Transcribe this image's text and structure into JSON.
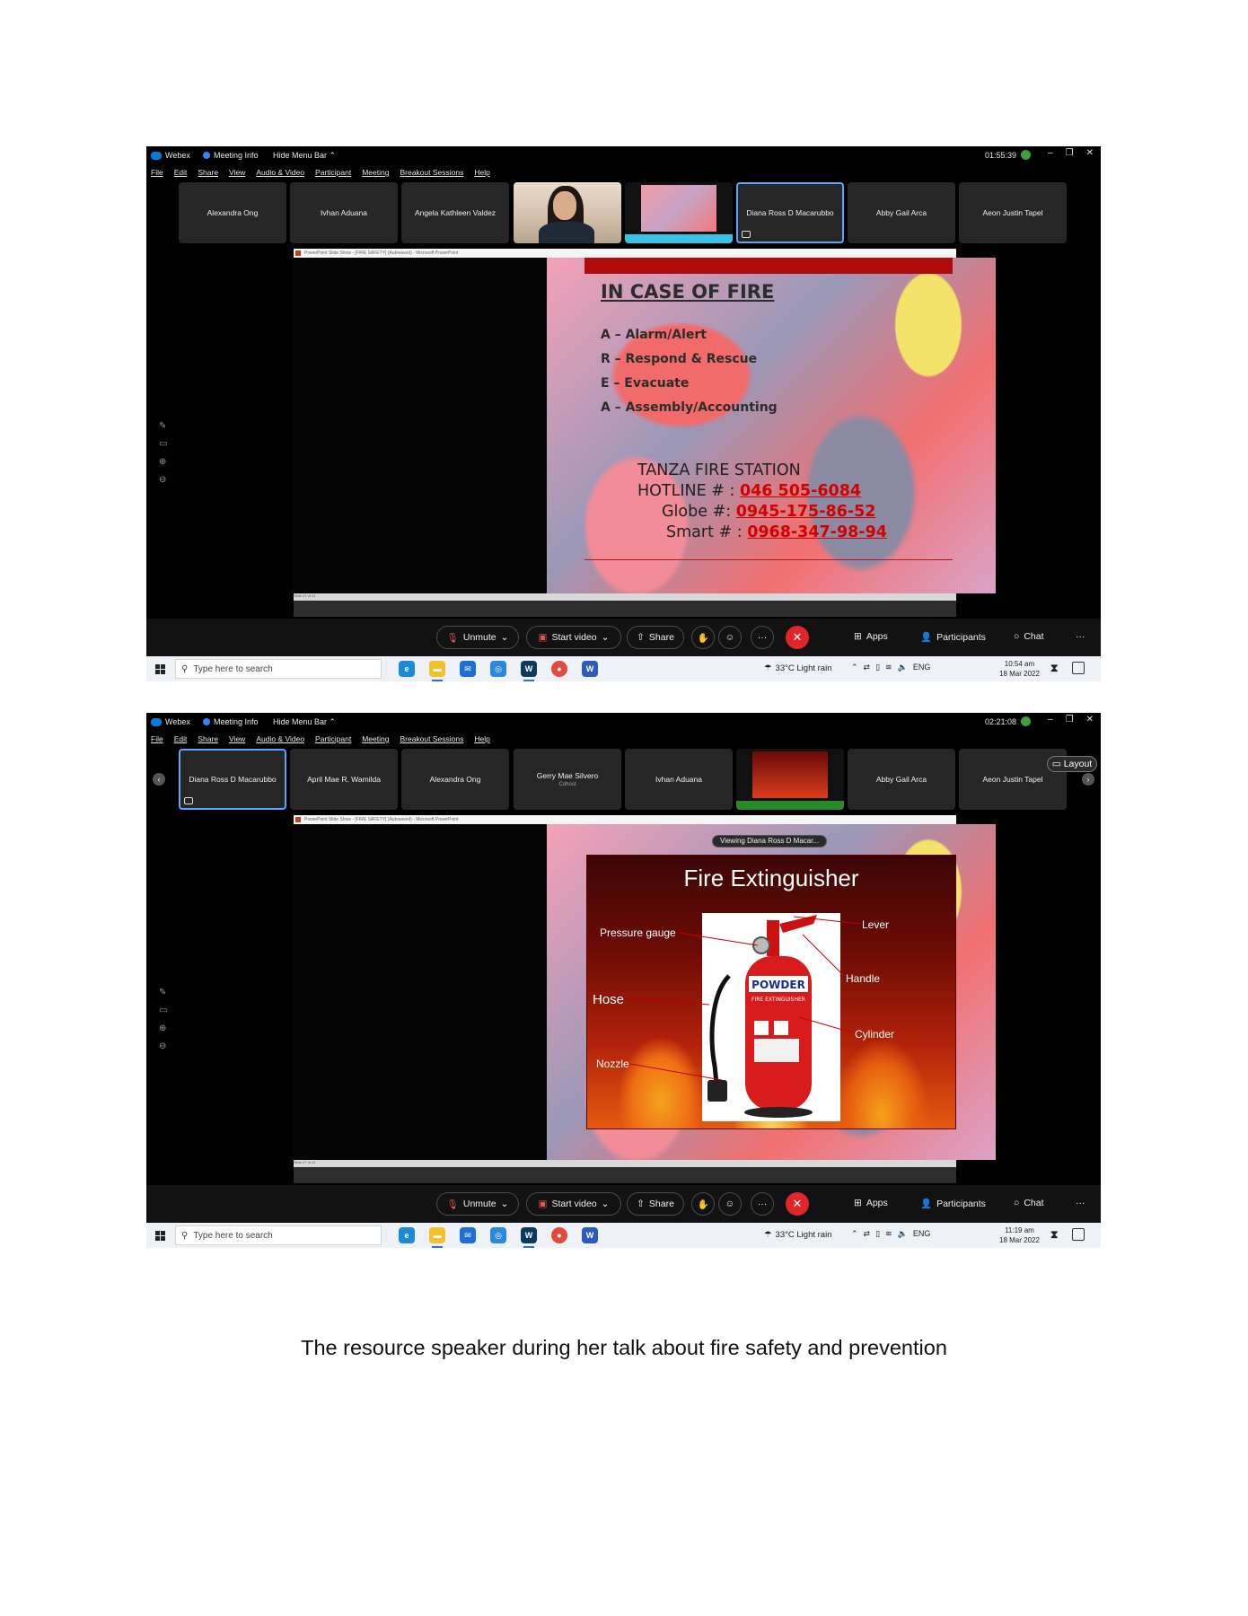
{
  "caption": "The resource speaker during her talk about fire safety and prevention",
  "common": {
    "app_name": "Webex",
    "meeting_info": "Meeting Info",
    "hide_menu_bar": "Hide Menu Bar",
    "menu": [
      "File",
      "Edit",
      "Share",
      "View",
      "Audio & Video",
      "Participant",
      "Meeting",
      "Breakout Sessions",
      "Help"
    ],
    "controls": {
      "unmute": "Unmute",
      "start_video": "Start video",
      "share": "Share",
      "apps": "Apps",
      "participants": "Participants",
      "chat": "Chat"
    },
    "taskbar": {
      "search_placeholder": "Type here to search",
      "weather": "33°C  Light rain",
      "language": "ENG"
    }
  },
  "shot1": {
    "timer": "01:55:39",
    "tiles": [
      "Alexandra Ong",
      "Ivhan Aduana",
      "Angela Kathleen Valdez",
      "",
      "",
      "Diana Ross D Macarubbo",
      "Abby Gail Arca",
      "Aeon Justin Tapel"
    ],
    "ppt_title": "PowerPoint Slide Show - [FIRE SAFETY] (Autosaved) - Microsoft PowerPoint",
    "slide_status": "Slide 21 of 41",
    "slide": {
      "title": "IN CASE OF FIRE",
      "race": [
        "A – Alarm/Alert",
        "R – Respond & Rescue",
        "E – Evacuate",
        "A – Assembly/Accounting"
      ],
      "station": "TANZA FIRE STATION",
      "hotline_label": "HOTLINE # : ",
      "hotline": "046 505-6084",
      "globe_label": "Globe #: ",
      "globe": "0945-175-86-52",
      "smart_label": "Smart # : ",
      "smart": "0968-347-98-94"
    },
    "time": "10:54 am",
    "date": "18 Mar 2022"
  },
  "shot2": {
    "timer": "02:21:08",
    "tiles": [
      "Diana Ross D Macarubbo",
      "April Mae R. Wamilda",
      "Alexandra Ong",
      "Gerry Mae Silvero",
      "Ivhan Aduana",
      "",
      "Abby Gail Arca",
      "Aeon Justin Tapel"
    ],
    "tile_sub": "Cohost",
    "viewing": "Viewing Diana Ross D Macar...",
    "layout": "Layout",
    "ppt_title": "PowerPoint Slide Show - [FIRE SAFETY] (Autosaved) - Microsoft PowerPoint",
    "slide_status": "Slide 27 of 41",
    "slide": {
      "title": "Fire Extinguisher",
      "labels": {
        "pressure_gauge": "Pressure gauge",
        "lever": "Lever",
        "handle": "Handle",
        "hose": "Hose",
        "cylinder": "Cylinder",
        "nozzle": "Nozzle"
      },
      "powder": "POWDER",
      "extinguisher_text": "FIRE EXTINGUISHER"
    },
    "time": "11:19 am",
    "date": "18 Mar 2022"
  }
}
